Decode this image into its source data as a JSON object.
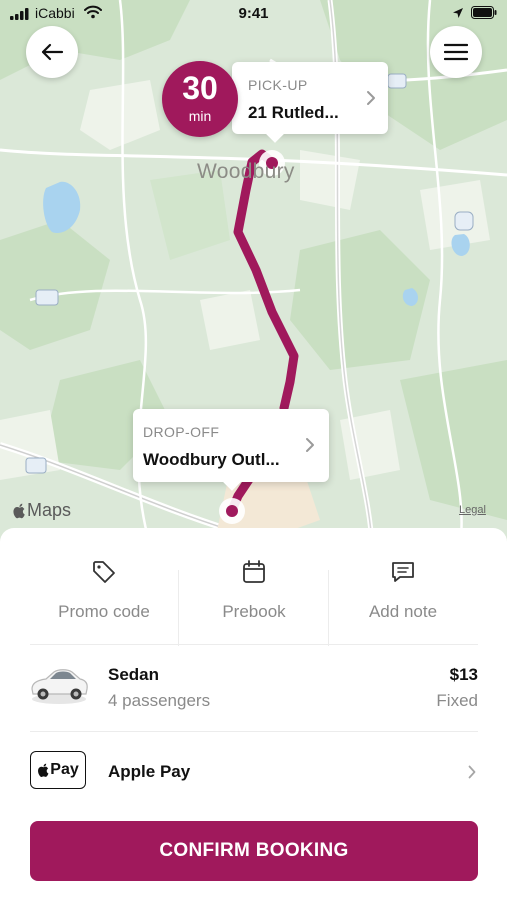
{
  "status_bar": {
    "carrier": "iCabbi",
    "time": "9:41"
  },
  "map": {
    "place_label": "Woodbury",
    "attribution": "Maps",
    "legal": "Legal",
    "route_color": "#a0195c",
    "pickup": {
      "label": "PICK-UP",
      "address": "21 Rutled..."
    },
    "dropoff": {
      "label": "DROP-OFF",
      "address": "Woodbury Outl..."
    },
    "eta": {
      "value": "30",
      "unit": "min"
    }
  },
  "actions": [
    {
      "label": "Promo code",
      "icon": "tag-icon"
    },
    {
      "label": "Prebook",
      "icon": "calendar-icon"
    },
    {
      "label": "Add note",
      "icon": "message-icon"
    }
  ],
  "vehicle": {
    "name": "Sedan",
    "passengers": "4 passengers",
    "price": "$13",
    "price_type": "Fixed"
  },
  "payment": {
    "logo_text": "Pay",
    "method": "Apple Pay"
  },
  "confirm_button": {
    "label": "CONFIRM BOOKING"
  },
  "colors": {
    "accent": "#a0195c",
    "map_base": "#dfeadd",
    "map_park": "#c7dfc0",
    "water": "#a9d3ef"
  }
}
